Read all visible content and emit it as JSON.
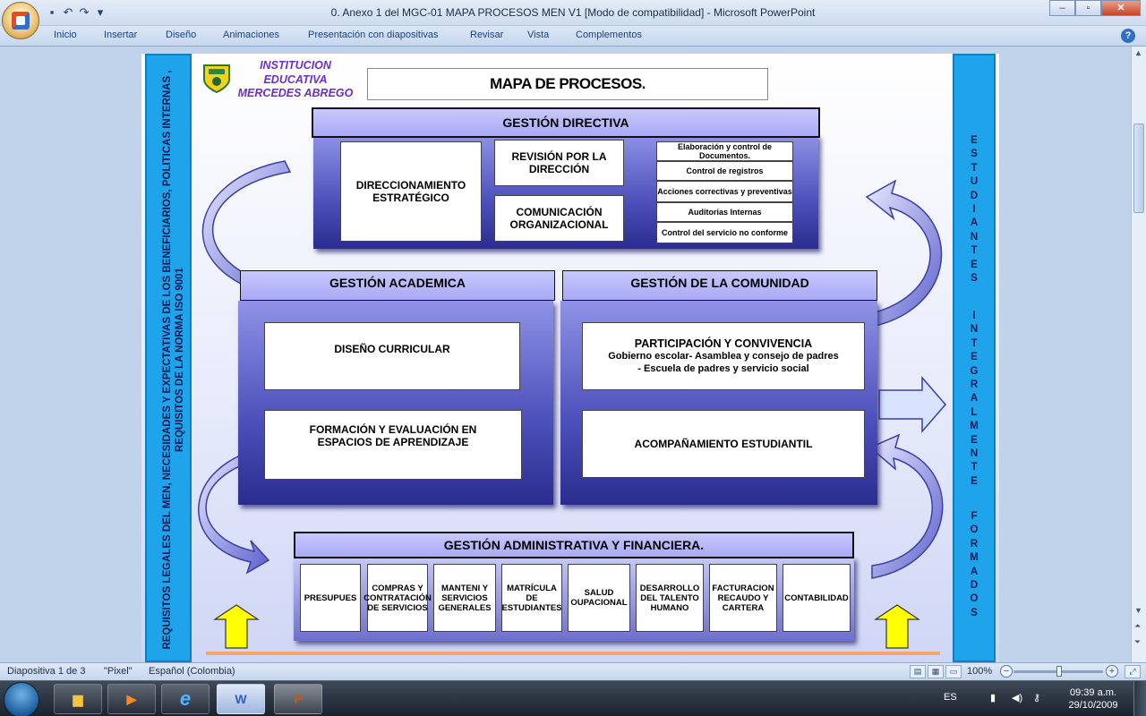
{
  "window": {
    "title": "0. Anexo 1 del MGC-01 MAPA PROCESOS MEN V1 [Modo de compatibilidad] - Microsoft PowerPoint",
    "minimize": "–",
    "maximize": "▫",
    "close": "✕"
  },
  "quick_access": [
    "save-icon",
    "undo-icon",
    "redo-icon",
    "customize-icon"
  ],
  "ribbon": {
    "tabs": [
      "Inicio",
      "Insertar",
      "Diseño",
      "Animaciones",
      "Presentación con diapositivas",
      "Revisar",
      "Vista",
      "Complementos"
    ]
  },
  "slide": {
    "left_band": "REQUISITOS LEGALES  DEL MEN, NECESIDADES Y EXPECTATIVAS DE LOS BENEFICIARIOS, POLITICAS INTERNAS , REQUISITOS DE LA NORMA  ISO 9001",
    "right_band_top": "ESTUDIANTES",
    "right_band_mid": "INTEGRALMENTE",
    "right_band_bottom": "FORMADOS",
    "institution": [
      "INSTITUCION",
      "EDUCATIVA",
      "MERCEDES ABREGO"
    ],
    "title": "MAPA DE PROCESOS.",
    "directiva": {
      "header": "GESTIÓN  DIRECTIVA",
      "direccionamiento": "DIRECCIONAMIENTO ESTRATÉGICO",
      "revision": "REVISIÓN POR LA DIRECCIÓN",
      "comunicacion": "COMUNICACIÓN ORGANIZACIONAL",
      "docs": [
        "Elaboración y control de Documentos.",
        "Control de registros",
        "Acciones correctivas y preventivas",
        "Auditorias Internas",
        "Control del servicio no conforme"
      ]
    },
    "academica": {
      "header": "GESTIÓN ACADEMICA",
      "diseno": "DISEÑO CURRICULAR",
      "formacion": "FORMACIÓN  Y EVALUACIÓN  EN ESPACIOS DE APRENDIZAJE"
    },
    "comunidad": {
      "header": "GESTIÓN DE LA COMUNIDAD",
      "participacion_title": "PARTICIPACIÓN  Y CONVIVENCIA",
      "participacion_line1": "Gobierno escolar- Asamblea y  consejo de padres",
      "participacion_line2": "- Escuela de padres y servicio social",
      "acompanamiento": "ACOMPAÑAMIENTO  ESTUDIANTIL"
    },
    "administrativa": {
      "header": "GESTIÓN  ADMINISTRATIVA  Y FINANCIERA.",
      "items": [
        "PRESUPUES",
        "COMPRAS Y CONTRATACIÓN DE SERVICIOS",
        "MANTENI Y SERVICIOS GENERALES",
        "MATRÍCULA DE ESTUDIANTES",
        "SALUD OUPACIONAL",
        "DESARROLLO DEL TALENTO HUMANO",
        "FACTURACION RECAUDO Y CARTERA",
        "CONTABILIDAD"
      ]
    },
    "colors": {
      "band": "#1fa3ea",
      "panel": "#4b4fb9",
      "header": "#b4b4fa",
      "arrow_yellow": "#ffff00"
    }
  },
  "status": {
    "slide": "Diapositiva 1 de 3",
    "theme": "\"Pixel\"",
    "language": "Español (Colombia)",
    "zoom": "100%"
  },
  "taskbar": {
    "language": "ES",
    "time": "09:39 a.m.",
    "date": "29/10/2009",
    "apps": [
      "explorer-icon",
      "media-player-icon",
      "internet-explorer-icon",
      "word-icon",
      "powerpoint-icon"
    ]
  }
}
